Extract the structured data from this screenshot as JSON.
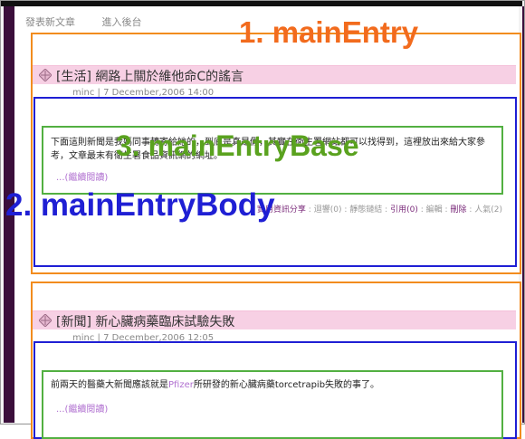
{
  "topnav": {
    "items": [
      "發表新文章",
      "進入後台"
    ]
  },
  "entries": [
    {
      "title": "[生活] 網路上關於維他命C的謠言",
      "meta": "minc | 7 December,2006 14:00",
      "body": "下面這則新聞是我媽同事轉寄給她的，到底是真是假，其實在衛生署網站都可以找得到，這裡放出來給大家參考，文章最末有衛生署食品資訊網的網址。",
      "more": "...(繼續閱讀)",
      "footer": {
        "category": "實用資訊分享",
        "trackback": "迴響(0)",
        "permalink": "靜態鏈結",
        "quote": "引用(0)",
        "edit": "編輯",
        "delete": "刪除",
        "views": "人氣(2)"
      }
    },
    {
      "title": "[新聞] 新心臟病藥臨床試驗失敗",
      "meta": "minc | 7 December,2006 12:05",
      "body_prefix": "前兩天的醫藥大新聞應該就是",
      "body_highlight": "Pfizer",
      "body_suffix": "所研發的新心臟病藥torcetrapib失敗的事了。",
      "more": "...(繼續閱讀)"
    }
  ],
  "annotations": {
    "entry": "1. mainEntry",
    "body": "2. mainEntryBody",
    "base": "3. mainEntryBase"
  },
  "colors": {
    "entry": "#f28c1e",
    "body": "#1f1fd4",
    "base": "#52b041",
    "title_bg": "#f7d0e4"
  }
}
